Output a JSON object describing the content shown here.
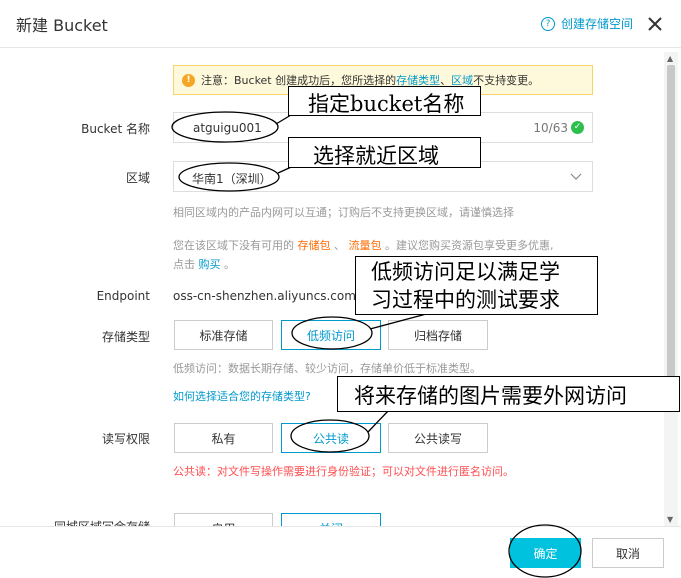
{
  "header": {
    "title": "新建 Bucket",
    "help_icon": "?",
    "help_link": "创建存储空间"
  },
  "notice": {
    "prefix": "注意：Bucket 创建成功后，您所选择的",
    "link1": "存储类型",
    "sep": "、",
    "link2": "区域",
    "suffix": "不支持变更。"
  },
  "form": {
    "name_label": "Bucket 名称",
    "name_value": "atguigu001",
    "name_counter": "10/63",
    "region_label": "区域",
    "region_value": "华南1（深圳）",
    "region_hint": "相同区域内的产品内网可以互通；订购后不支持更换区域，请谨慎选择",
    "package_hint_prefix": "您在该区域下没有可用的",
    "package_link1": "存储包",
    "package_sep": "、",
    "package_link2": "流量包",
    "package_hint_suffix": "。建议您购买资源包享受更多优惠,",
    "package_hint_line2_prefix": "点击",
    "package_hint_buy": "购买",
    "package_hint_line2_suffix": "。",
    "endpoint_label": "Endpoint",
    "endpoint_value": "oss-cn-shenzhen.aliyuncs.com",
    "storage_label": "存储类型",
    "storage_options": [
      "标准存储",
      "低频访问",
      "归档存储"
    ],
    "storage_hint": "低频访问：数据长期存储、较少访问，存储单价低于标准类型。",
    "storage_link": "如何选择适合您的存储类型?",
    "acl_label": "读写权限",
    "acl_options": [
      "私有",
      "公共读",
      "公共读写"
    ],
    "acl_hint": "公共读：对文件写操作需要进行身份验证；可以对文件进行匿名访问。",
    "redundancy_label": "同城区域冗余存储",
    "redundancy_options": [
      "启用",
      "关闭"
    ]
  },
  "footer": {
    "confirm": "确定",
    "cancel": "取消"
  },
  "annotations": {
    "name_callout": "指定bucket名称",
    "region_callout": "选择就近区域",
    "storage_callout_line1": "低频访问足以满足学",
    "storage_callout_line2": "习过程中的测试要求",
    "acl_callout": "将来存储的图片需要外网访问"
  },
  "colors": {
    "accent": "#0099cc",
    "primary_button": "#00c1de",
    "notice_bg": "#fff9db",
    "warning": "#f5a623",
    "error_text": "#ff4d4f",
    "success": "#2dbf4e"
  }
}
